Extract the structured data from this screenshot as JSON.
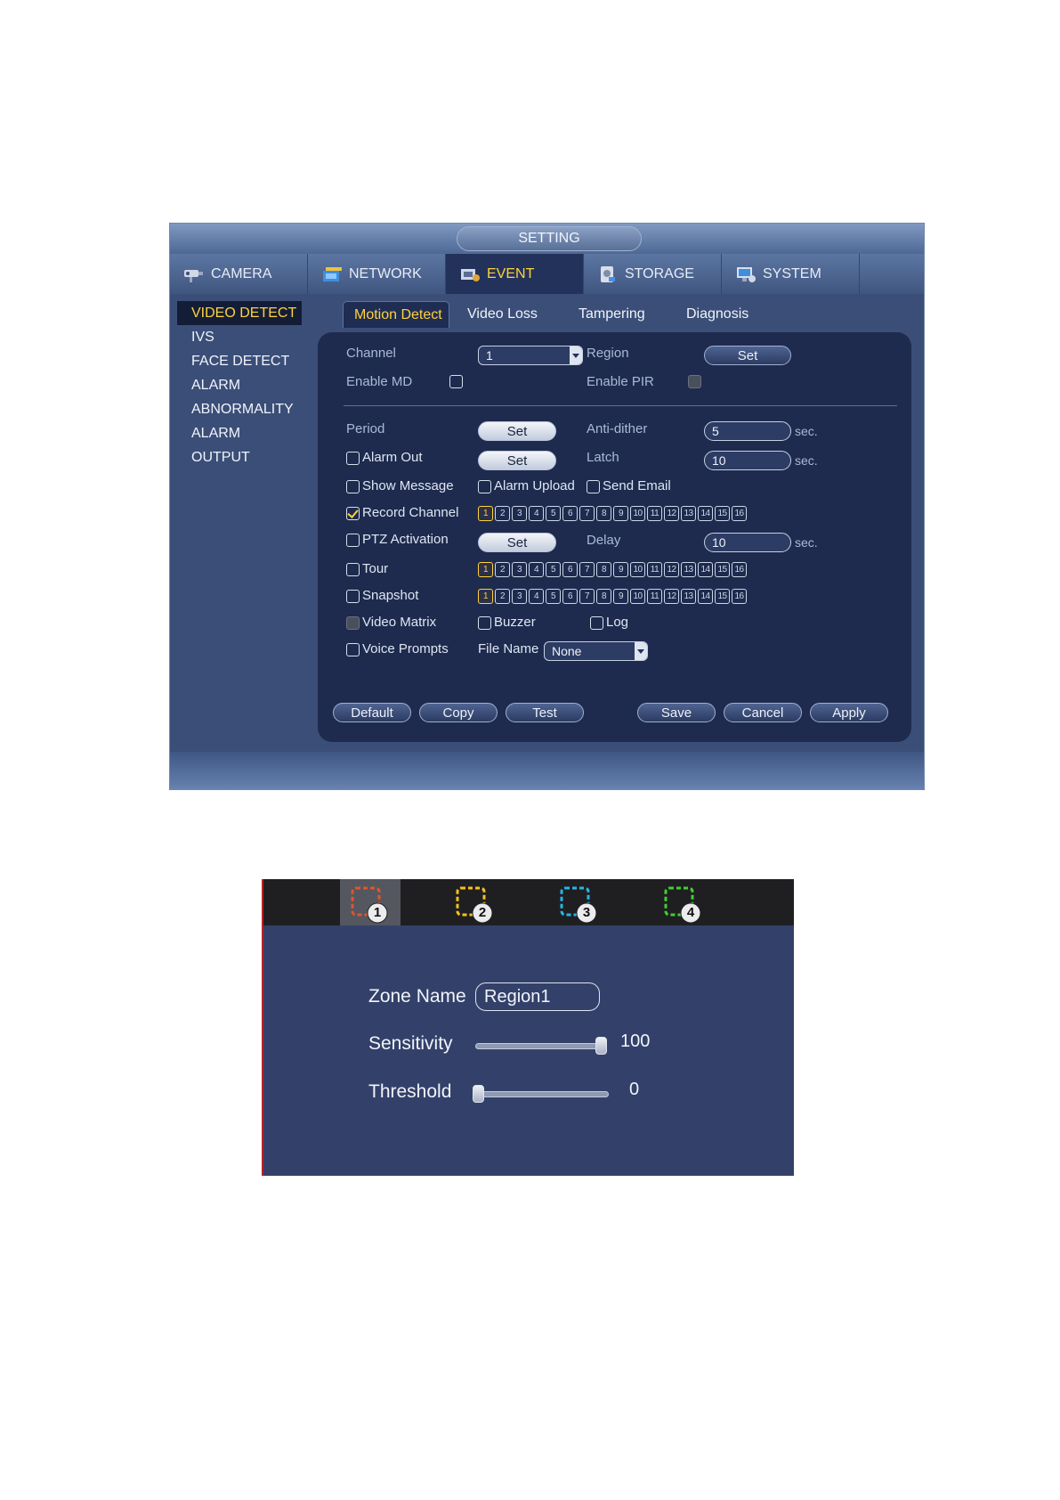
{
  "window": {
    "title": "SETTING",
    "main_tabs": [
      {
        "label": "CAMERA",
        "icon": "camera-icon"
      },
      {
        "label": "NETWORK",
        "icon": "network-icon"
      },
      {
        "label": "EVENT",
        "icon": "event-icon",
        "active": true
      },
      {
        "label": "STORAGE",
        "icon": "storage-icon"
      },
      {
        "label": "SYSTEM",
        "icon": "system-icon"
      }
    ],
    "side_nav": [
      {
        "label": "VIDEO DETECT",
        "active": true
      },
      {
        "label": "IVS"
      },
      {
        "label": "FACE DETECT"
      },
      {
        "label": "ALARM"
      },
      {
        "label": "ABNORMALITY"
      },
      {
        "label": "ALARM OUTPUT"
      }
    ],
    "sub_tabs": [
      {
        "label": "Motion Detect",
        "active": true
      },
      {
        "label": "Video Loss"
      },
      {
        "label": "Tampering"
      },
      {
        "label": "Diagnosis"
      }
    ],
    "form": {
      "channel_label": "Channel",
      "channel_value": "1",
      "region_label": "Region",
      "region_button": "Set",
      "enable_md_label": "Enable MD",
      "enable_md_checked": false,
      "enable_pir_label": "Enable PIR",
      "enable_pir_disabled": true,
      "period_label": "Period",
      "period_button": "Set",
      "anti_dither_label": "Anti-dither",
      "anti_dither_value": "5",
      "unit_sec": "sec.",
      "alarm_out_label": "Alarm Out",
      "alarm_out_button": "Set",
      "latch_label": "Latch",
      "latch_value": "10",
      "show_message_label": "Show Message",
      "alarm_upload_label": "Alarm Upload",
      "send_email_label": "Send Email",
      "record_channel_label": "Record Channel",
      "record_channel_checked": true,
      "ptz_activation_label": "PTZ Activation",
      "ptz_button": "Set",
      "delay_label": "Delay",
      "delay_value": "10",
      "tour_label": "Tour",
      "snapshot_label": "Snapshot",
      "video_matrix_label": "Video Matrix",
      "buzzer_label": "Buzzer",
      "log_label": "Log",
      "voice_prompts_label": "Voice Prompts",
      "file_name_label": "File Name",
      "file_name_value": "None",
      "channels": [
        "1",
        "2",
        "3",
        "4",
        "5",
        "6",
        "7",
        "8",
        "9",
        "10",
        "11",
        "12",
        "13",
        "14",
        "15",
        "16"
      ],
      "record_selected": [
        "1"
      ],
      "tour_selected": [
        "1"
      ],
      "snapshot_selected": [
        "1"
      ]
    },
    "buttons": {
      "default": "Default",
      "copy": "Copy",
      "test": "Test",
      "save": "Save",
      "cancel": "Cancel",
      "apply": "Apply"
    }
  },
  "region_window": {
    "zones": [
      {
        "number": "1",
        "color": "#e0552b",
        "active": true
      },
      {
        "number": "2",
        "color": "#f2c21b"
      },
      {
        "number": "3",
        "color": "#27b5e6"
      },
      {
        "number": "4",
        "color": "#3fd12e"
      }
    ],
    "zone_name_label": "Zone Name",
    "zone_name_value": "Region1",
    "sensitivity_label": "Sensitivity",
    "sensitivity_value": "100",
    "sensitivity_level": 1.0,
    "threshold_label": "Threshold",
    "threshold_value": "0",
    "threshold_level": 0.0
  },
  "colors": {
    "accent": "#ffd23c",
    "panel": "#1e2b4e",
    "window": "#3a4e78"
  }
}
